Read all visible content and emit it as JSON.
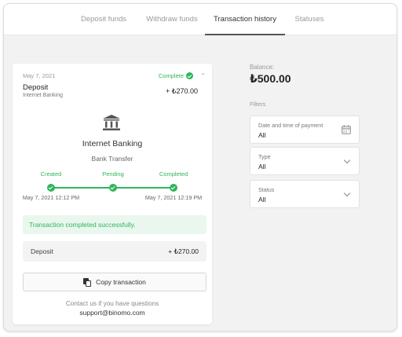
{
  "tabs": [
    {
      "label": "Deposit funds"
    },
    {
      "label": "Withdraw funds"
    },
    {
      "label": "Transaction history"
    },
    {
      "label": "Statuses"
    }
  ],
  "transaction": {
    "date": "May 7, 2021",
    "status": "Complete",
    "title": "Deposit",
    "subtitle": "Internet Banking",
    "amount": "+ ₺270.00",
    "method_name": "Internet Banking",
    "method_type": "Bank Transfer",
    "steps": [
      {
        "label": "Created",
        "time": "May 7, 2021 12:12 PM"
      },
      {
        "label": "Pending",
        "time": ""
      },
      {
        "label": "Completed",
        "time": "May 7, 2021 12:19 PM"
      }
    ],
    "success_message": "Transaction completed successfully.",
    "deposit_label": "Deposit",
    "deposit_amount": "+ ₺270.00",
    "copy_label": "Copy transaction",
    "contact_text": "Contact us if you have questions",
    "email": "support@binomo.com"
  },
  "balance": {
    "label": "Balance:",
    "value": "₺500.00"
  },
  "filters": {
    "label": "Filters",
    "items": [
      {
        "label": "Date and time of payment",
        "value": "All"
      },
      {
        "label": "Type",
        "value": "All"
      },
      {
        "label": "Status",
        "value": "All"
      }
    ]
  },
  "colors": {
    "accent_green": "#2fb55c",
    "success_bg": "#eaf7ee"
  },
  "icons": [
    "check-circle-icon",
    "chevron-up-icon",
    "bank-icon",
    "copy-icon",
    "calendar-icon",
    "chevron-down-icon"
  ]
}
